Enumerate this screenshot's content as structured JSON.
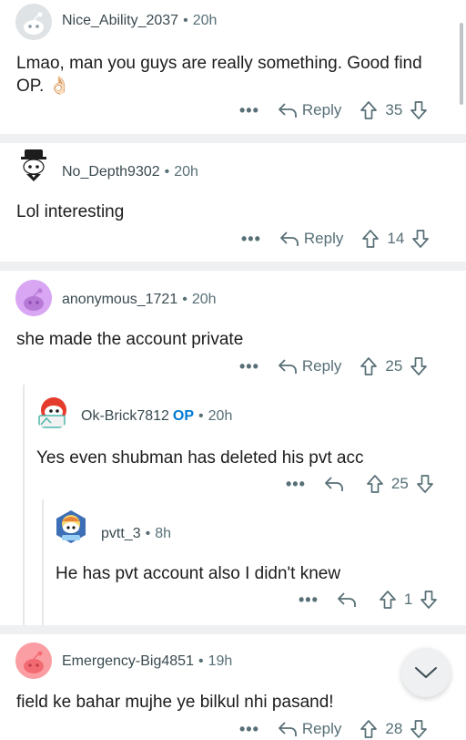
{
  "comments": [
    {
      "username": "Nice_Ability_2037",
      "time": "20h",
      "text": "Lmao, man you guys are really something. Good find OP.",
      "emoji": "👌🏻",
      "reply_label": "Reply",
      "votes": "35",
      "more": "•••"
    },
    {
      "username": "No_Depth9302",
      "time": "20h",
      "text": "Lol interesting",
      "reply_label": "Reply",
      "votes": "14",
      "more": "•••"
    },
    {
      "username": "anonymous_1721",
      "time": "20h",
      "text": "she made the account private",
      "reply_label": "Reply",
      "votes": "25",
      "more": "•••"
    },
    {
      "username": "Ok-Brick7812",
      "op_badge": "OP",
      "time": "20h",
      "text": "Yes even shubman has deleted his pvt acc",
      "votes": "25",
      "more": "•••"
    },
    {
      "username": "pvtt_3",
      "time": "8h",
      "text": "He has pvt account also I didn't knew",
      "votes": "1",
      "more": "•••"
    },
    {
      "username": "Emergency-Big4851",
      "time": "19h",
      "text": "field ke bahar mujhe ye bilkul nhi pasand!",
      "reply_label": "Reply",
      "votes": "28",
      "more": "•••"
    }
  ],
  "separator_dot": "•",
  "colors": {
    "accent_op": "#0079d3",
    "meta": "#576f76",
    "separator": "#eef0f1"
  }
}
